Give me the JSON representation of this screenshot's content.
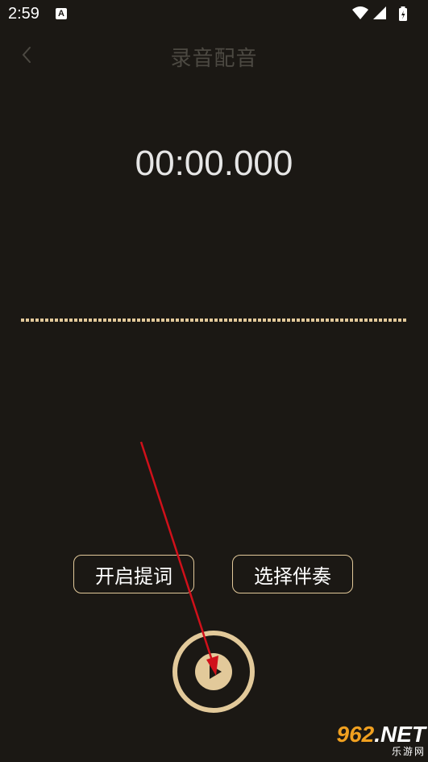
{
  "status_bar": {
    "time": "2:59",
    "notification_icon_letter": "A",
    "icons": [
      "wifi-icon",
      "signal-icon",
      "battery-icon"
    ]
  },
  "header": {
    "title": "录音配音",
    "back_icon": "chevron-left-icon"
  },
  "timer": {
    "value": "00:00.000"
  },
  "actions": {
    "prompter_label": "开启提词",
    "accompaniment_label": "选择伴奏"
  },
  "record": {
    "icon": "play-triangle-icon"
  },
  "watermark": {
    "number": "962",
    "domain": ".NET",
    "subtitle": "乐游网"
  },
  "colors": {
    "background": "#1b1814",
    "accent": "#e2c99a",
    "title_muted": "#4c4942",
    "annotation_arrow": "#d0101a"
  }
}
